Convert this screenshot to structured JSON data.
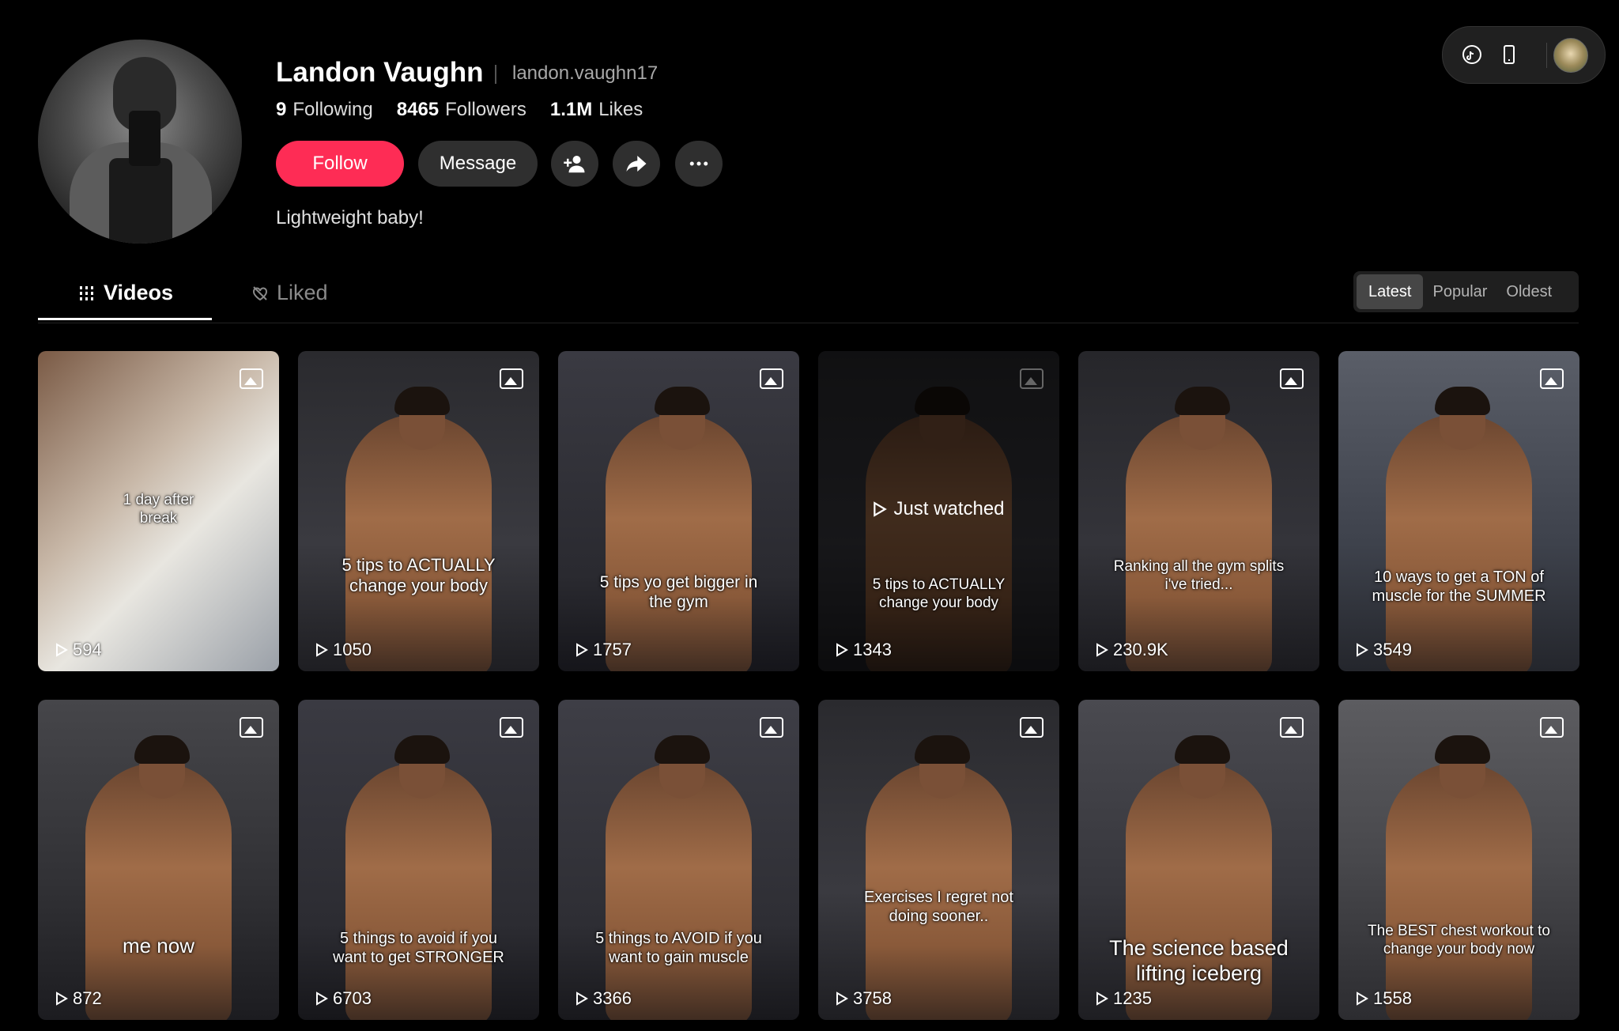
{
  "profile": {
    "name": "Landon Vaughn",
    "username": "landon.vaughn17",
    "stats": [
      {
        "num": "9",
        "label": "Following"
      },
      {
        "num": "8465",
        "label": "Followers"
      },
      {
        "num": "1.1M",
        "label": "Likes"
      }
    ],
    "follow_label": "Follow",
    "message_label": "Message",
    "bio": "Lightweight baby!"
  },
  "tabs": {
    "videos": "Videos",
    "liked": "Liked"
  },
  "sort": {
    "options": [
      "Latest",
      "Popular",
      "Oldest"
    ],
    "selected": "Latest"
  },
  "videos": [
    {
      "caption": "1 day after\nbreak",
      "views": "594",
      "just_watched": false
    },
    {
      "caption": "5 tips to ACTUALLY\nchange your body",
      "views": "1050",
      "just_watched": false
    },
    {
      "caption": "5 tips yo get bigger in\nthe gym",
      "views": "1757",
      "just_watched": false
    },
    {
      "caption": "5 tips to ACTUALLY\nchange your body",
      "views": "1343",
      "just_watched": true,
      "just_watched_label": "Just watched"
    },
    {
      "caption": "Ranking all the gym splits\ni've tried...",
      "views": "230.9K",
      "just_watched": false
    },
    {
      "caption": "10 ways to get a TON of\nmuscle for the SUMMER",
      "views": "3549",
      "just_watched": false
    },
    {
      "caption": "me now",
      "views": "872",
      "just_watched": false
    },
    {
      "caption": "5 things to avoid if you\nwant to get STRONGER",
      "views": "6703",
      "just_watched": false
    },
    {
      "caption": "5 things to AVOID if you\nwant to gain muscle",
      "views": "3366",
      "just_watched": false
    },
    {
      "caption": "Exercises I regret not\ndoing sooner..",
      "views": "3758",
      "just_watched": false
    },
    {
      "caption": "The science based\nlifting iceberg",
      "views": "1235",
      "just_watched": false
    },
    {
      "caption": "The BEST chest workout to\nchange your body now",
      "views": "1558",
      "just_watched": false
    }
  ],
  "colors": {
    "accent": "#fe2c55",
    "background": "#000000",
    "button_dark": "#2f2f2f"
  },
  "icons": {
    "topbar": [
      "tiktok-icon",
      "phone-icon"
    ],
    "actions": [
      "add-friend-icon",
      "share-icon",
      "more-icon"
    ],
    "card": [
      "photo-icon",
      "play-icon"
    ]
  }
}
